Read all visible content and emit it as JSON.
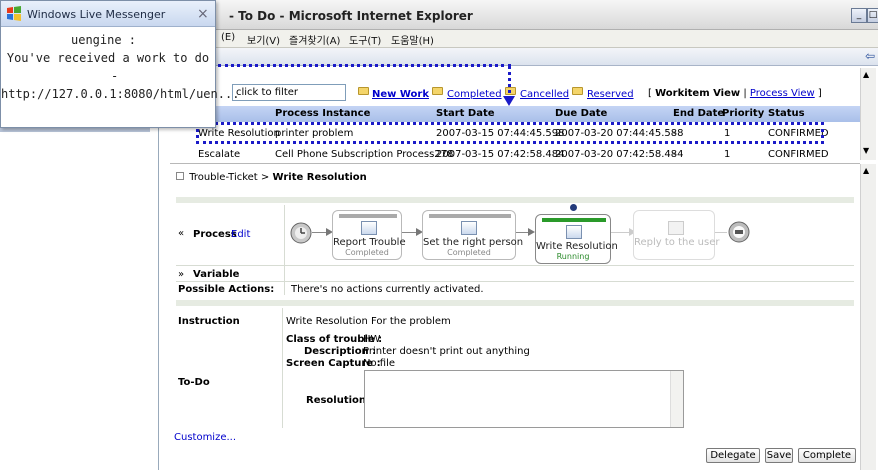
{
  "browser": {
    "title": "- To Do - Microsoft Internet Explorer",
    "menu": [
      "(E)",
      "보기(V)",
      "즐겨찾기(A)",
      "도구(T)",
      "도움말(H)"
    ],
    "toolbar_arrow": "⇦",
    "window_buttons": [
      "_",
      "□"
    ]
  },
  "messenger": {
    "title": "Windows Live Messenger",
    "close": "×",
    "line1": "uengine          :",
    "line2": "You've received a work to do",
    "line3": "-",
    "line4": "http://127.0.0.1:8080/html/uen...",
    "colors": {
      "flag_red": "#e8391a",
      "flag_green": "#4aa830",
      "flag_blue": "#2a72d8",
      "flag_yellow": "#f2c12e"
    }
  },
  "worklist": {
    "filter_value": "click to filter",
    "folders": {
      "new_work": "New Work",
      "completed": "Completed",
      "cancelled": "Cancelled",
      "reserved": "Reserved"
    },
    "view_switch": {
      "open": "[",
      "workitem_view": "Workitem View",
      "divider": "|",
      "process_view": "Process View",
      "close": "]"
    },
    "columns": {
      "process_instance": "Process Instance",
      "start_date": "Start Date",
      "due_date": "Due Date",
      "end_date": "End Date",
      "priority": "Priority",
      "status": "Status"
    },
    "rows": [
      {
        "task": "Write Resolution",
        "process": "printer problem",
        "start": "2007-03-15 07:44:45.598",
        "due": "2007-03-20 07:44:45.588",
        "end": "-",
        "priority": "1",
        "status": "CONFIRMED"
      },
      {
        "task": "Escalate",
        "process": "Cell Phone Subscription Process278",
        "start": "2007-03-15 07:42:58.484",
        "due": "2007-03-20 07:42:58.484",
        "end": "-",
        "priority": "1",
        "status": "CONFIRMED"
      }
    ],
    "highlight_color": "#1a1ac8"
  },
  "detail": {
    "breadcrumb_prefix": "Trouble-Ticket >",
    "breadcrumb_current": "Write Resolution",
    "process_label": "Process",
    "process_edit": "Edit",
    "variable_label": "Variable",
    "possible_actions_label": "Possible Actions:",
    "possible_actions_value": "There's no actions currently activated.",
    "instruction_label": "Instruction",
    "instruction_value": "Write Resolution For the problem",
    "todo_label": "To-Do",
    "fields": {
      "class_of_trouble_label": "Class of trouble :",
      "class_of_trouble_value": "HW",
      "description_label": "Description :",
      "description_value": "Printer doesn't print out anything",
      "screen_capture_label": "Screen Capture :",
      "screen_capture_value": "No file",
      "resolution_label": "Resolution :",
      "resolution_value": ""
    },
    "customize_link": "Customize...",
    "buttons": {
      "delegate": "Delegate",
      "save": "Save",
      "complete": "Complete"
    }
  },
  "process_diagram": {
    "activities": [
      {
        "name": "Report Trouble",
        "status": "Completed",
        "state": "completed"
      },
      {
        "name": "Set the right person",
        "status": "Completed",
        "state": "completed"
      },
      {
        "name": "Write Resolution",
        "status": "Running",
        "state": "running"
      },
      {
        "name": "Reply to the user",
        "status": "",
        "state": "pending"
      }
    ],
    "colors": {
      "running": "#2a9a2a",
      "completed": "#9a9a9a",
      "pending": "#d8d8d8",
      "running_text": "#2a8a2a"
    }
  }
}
